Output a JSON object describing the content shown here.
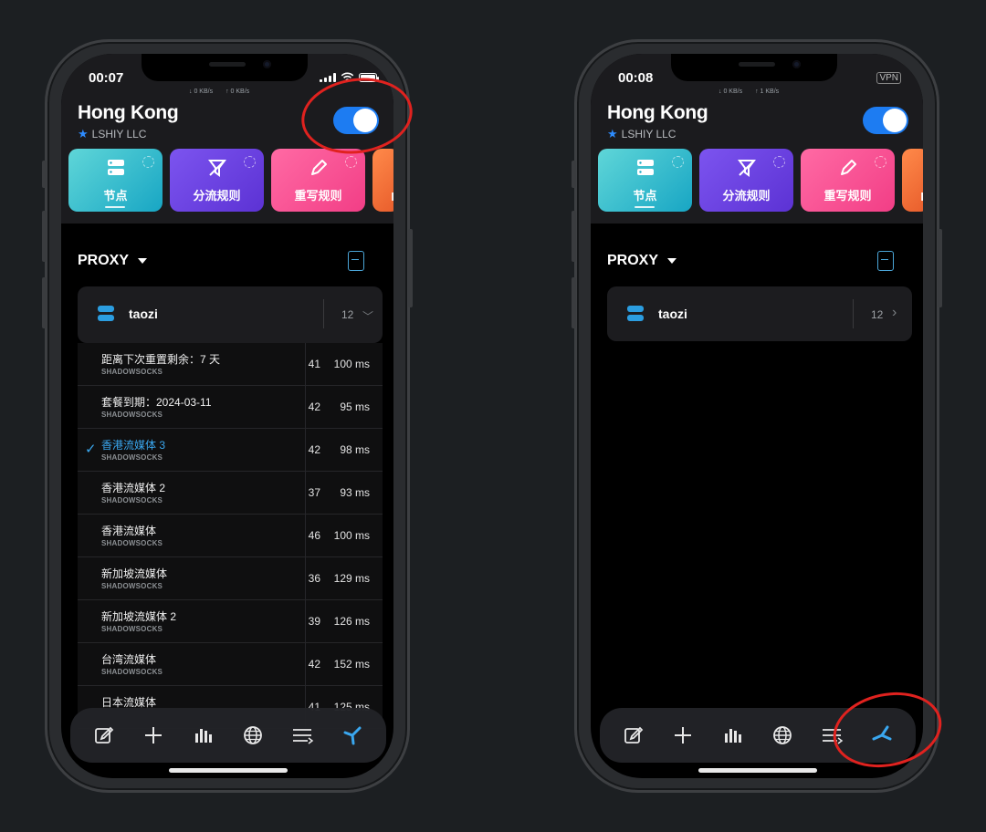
{
  "left": {
    "status": {
      "time": "00:07",
      "down": "↓ 0 KB/s",
      "up": "↑ 0 KB/s"
    },
    "header": {
      "title": "Hong Kong",
      "subtitle": "LSHIY LLC"
    },
    "tiles": [
      "节点",
      "分流规则",
      "重写规则",
      "I"
    ],
    "proxy_label": "PROXY",
    "group": {
      "name": "taozi",
      "count": "12",
      "chevron": "﹀"
    },
    "rows": [
      {
        "name": "距离下次重置剩余：7 天",
        "type": "SHADOWSOCKS",
        "num": "41",
        "ms": "100 ms",
        "active": false
      },
      {
        "name": "套餐到期：2024-03-11",
        "type": "SHADOWSOCKS",
        "num": "42",
        "ms": "95 ms",
        "active": false
      },
      {
        "name": "香港流媒体 3",
        "type": "SHADOWSOCKS",
        "num": "42",
        "ms": "98 ms",
        "active": true
      },
      {
        "name": "香港流媒体 2",
        "type": "SHADOWSOCKS",
        "num": "37",
        "ms": "93 ms",
        "active": false
      },
      {
        "name": "香港流媒体",
        "type": "SHADOWSOCKS",
        "num": "46",
        "ms": "100 ms",
        "active": false
      },
      {
        "name": "新加坡流媒体",
        "type": "SHADOWSOCKS",
        "num": "36",
        "ms": "129 ms",
        "active": false
      },
      {
        "name": "新加坡流媒体 2",
        "type": "SHADOWSOCKS",
        "num": "39",
        "ms": "126 ms",
        "active": false
      },
      {
        "name": "台湾流媒体",
        "type": "SHADOWSOCKS",
        "num": "42",
        "ms": "152 ms",
        "active": false
      },
      {
        "name": "日本流媒体",
        "type": "",
        "num": "41",
        "ms": "125 ms",
        "active": false
      }
    ]
  },
  "right": {
    "status": {
      "time": "00:08",
      "down": "↓ 0 KB/s",
      "up": "↑ 1 KB/s",
      "vpn": "VPN"
    },
    "header": {
      "title": "Hong Kong",
      "subtitle": "LSHIY LLC"
    },
    "tiles": [
      "节点",
      "分流规则",
      "重写规则",
      "I"
    ],
    "proxy_label": "PROXY",
    "group": {
      "name": "taozi",
      "count": "12",
      "chevron": "›"
    }
  },
  "tabbar": {
    "icons": [
      "edit-icon",
      "plus-icon",
      "stats-icon",
      "globe-icon",
      "list-icon",
      "fan-icon"
    ],
    "active_color": "#3aa7ef"
  },
  "colors": {
    "accent": "#1d7cf2",
    "annotation": "#e0221f"
  }
}
